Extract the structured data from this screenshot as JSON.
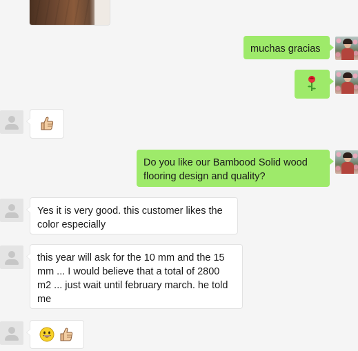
{
  "conversation": {
    "messages": [
      {
        "sender": "other",
        "type": "image",
        "description_icon": "photo-thumbnail"
      },
      {
        "sender": "self",
        "type": "text",
        "text": "muchas gracias"
      },
      {
        "sender": "self",
        "type": "emoji",
        "icons": [
          "rose-icon"
        ]
      },
      {
        "sender": "other",
        "type": "emoji",
        "icons": [
          "thumbs-up-icon"
        ]
      },
      {
        "sender": "self",
        "type": "text",
        "text": "Do you like our Bambood Solid wood flooring design and quality?"
      },
      {
        "sender": "other",
        "type": "text",
        "text": "Yes it is very good. this customer likes the color especially"
      },
      {
        "sender": "other",
        "type": "text",
        "text": "this year will ask for the 10 mm and the 15 mm ... I would believe that a total of 2800 m2 ... just wait until february march. he told me"
      },
      {
        "sender": "other",
        "type": "emoji",
        "icons": [
          "smiley-icon",
          "thumbs-up-icon"
        ]
      }
    ]
  },
  "colors": {
    "background": "#f5f5f5",
    "outgoing_bubble": "#9eea6a",
    "incoming_bubble": "#ffffff"
  }
}
